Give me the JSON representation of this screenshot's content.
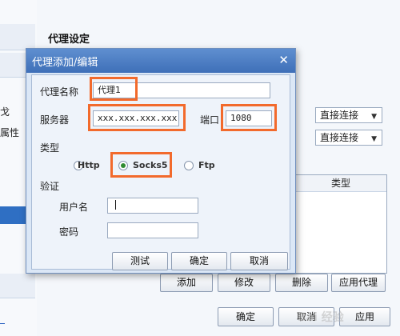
{
  "background": {
    "section_title": "代理设定",
    "sidebar_fragments": [
      "戈",
      "属性"
    ],
    "combo_1": "直接连接",
    "combo_2": "直接连接",
    "table_header": "类型",
    "buttons": {
      "add": "添加",
      "modify": "修改",
      "delete": "删除",
      "apply_proxy": "应用代理"
    },
    "footer": {
      "ok": "确定",
      "cancel": "取消",
      "apply": "应用"
    }
  },
  "dialog": {
    "title": "代理添加/编辑",
    "proxy_name_label": "代理名称",
    "proxy_name_value": "代理1",
    "server_label": "服务器",
    "server_value": "xxx.xxx.xxx.xxx",
    "port_label": "端口",
    "port_value": "1080",
    "type_label": "类型",
    "type_options": [
      "Http",
      "Socks5",
      "Ftp"
    ],
    "selected_type": "Socks5",
    "auth_label": "验证",
    "username_label": "用户名",
    "username_value": "",
    "password_label": "密码",
    "password_value": "",
    "buttons": {
      "test": "测试",
      "ok": "确定",
      "cancel": "取消"
    }
  },
  "watermark": "Bai 经验",
  "colors": {
    "highlight": "#f26a2c",
    "titlebar": "#3e6fb8",
    "selection": "#2f6fc3"
  }
}
